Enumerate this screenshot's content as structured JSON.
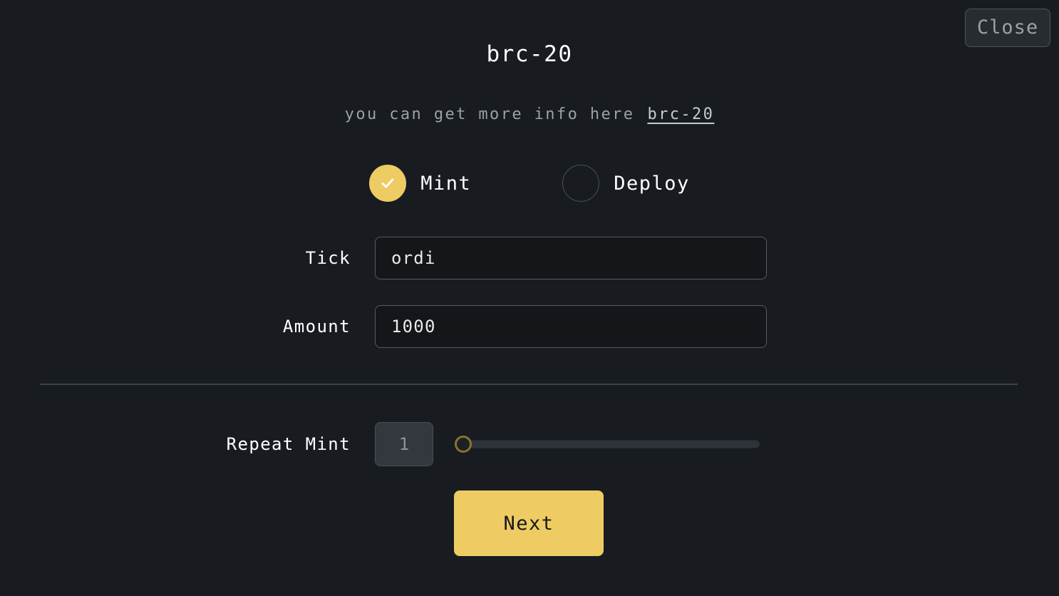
{
  "header": {
    "close_label": "Close",
    "title": "brc-20",
    "subtitle_text": "you can get more info here",
    "subtitle_link_label": "brc-20"
  },
  "mode_selector": {
    "options": [
      {
        "label": "Mint",
        "selected": true,
        "icon": "check-icon"
      },
      {
        "label": "Deploy",
        "selected": false,
        "icon": "empty-circle-icon"
      }
    ]
  },
  "form": {
    "fields": [
      {
        "label": "Tick",
        "value": "ordi",
        "placeholder": ""
      },
      {
        "label": "Amount",
        "value": "1000",
        "placeholder": ""
      }
    ]
  },
  "repeat": {
    "label": "Repeat Mint",
    "value": "",
    "placeholder": "1",
    "slider": {
      "value": 1,
      "min": 1,
      "max": 100,
      "fill_percent": 0
    }
  },
  "actions": {
    "next_label": "Next"
  },
  "colors": {
    "background": "#181c21",
    "accent": "#eecb63",
    "input_background": "#141619",
    "border": "#565c63",
    "muted_text": "#9ba1a7",
    "divider": "#3d444b",
    "slider_track": "#2e3339",
    "slider_handle_ring": "#8a7230"
  }
}
